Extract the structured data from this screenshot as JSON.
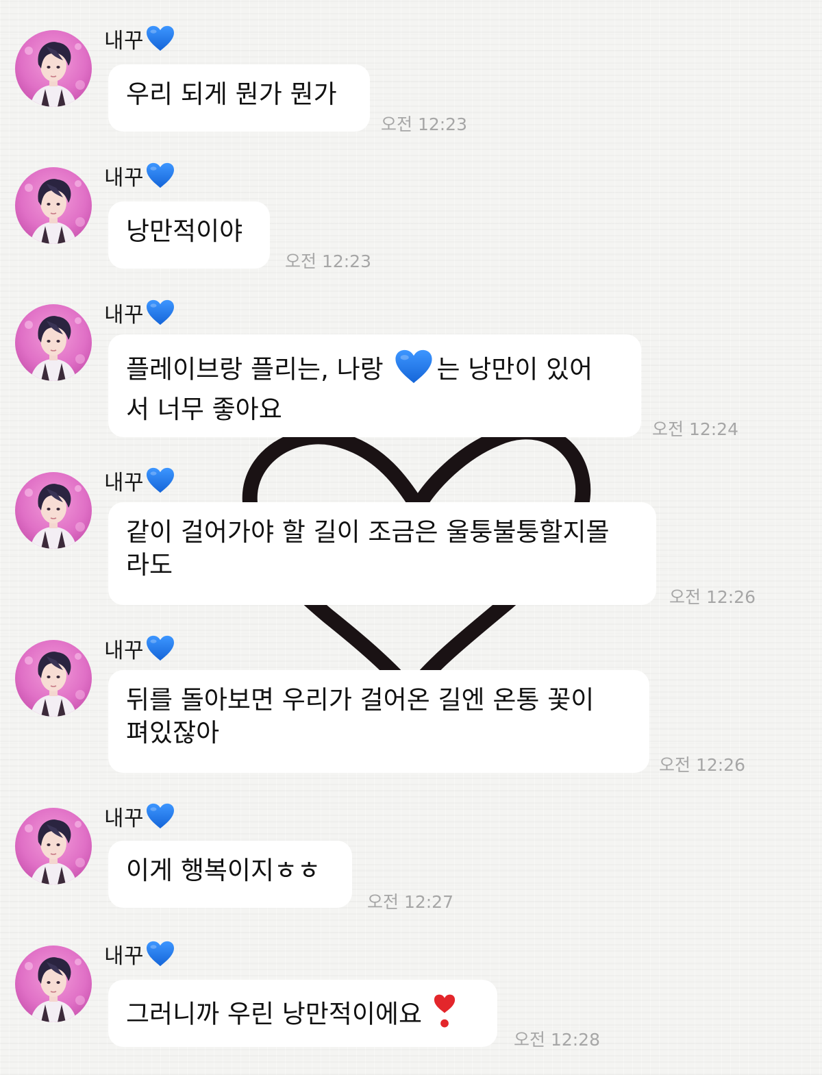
{
  "colors": {
    "background": "#f4f4f2",
    "bubble": "#ffffff",
    "text": "#111111",
    "timestamp": "#a6a6a6",
    "sender_heart": "#1f7ae8",
    "red_heart": "#e3262b",
    "avatar_bg": "#e070c6"
  },
  "icons": {
    "sender_badge": "blue-heart-icon",
    "inline": "blue-heart-icon",
    "ending": "red-heart-exclamation-icon",
    "background": "hand-drawn-heart"
  },
  "messages": [
    {
      "sender": "내꾸",
      "text": "우리 되게 뭔가 뭔가",
      "time": "오전 12:23"
    },
    {
      "sender": "내꾸",
      "text": "낭만적이야",
      "time": "오전 12:23"
    },
    {
      "sender": "내꾸",
      "text_a": "플레이브랑 플리는, 나랑 ",
      "text_b": "는 낭만이 있어",
      "text_c": "서 너무 좋아요",
      "time": "오전 12:24"
    },
    {
      "sender": "내꾸",
      "text": "같이 걸어가야 할 길이 조금은 울퉁불퉁할지몰\n라도",
      "time": "오전 12:26"
    },
    {
      "sender": "내꾸",
      "text": "뒤를 돌아보면 우리가 걸어온 길엔 온통 꽃이\n펴있잖아",
      "time": "오전 12:26"
    },
    {
      "sender": "내꾸",
      "text": "이게 행복이지ㅎㅎ",
      "time": "오전 12:27"
    },
    {
      "sender": "내꾸",
      "text": "그러니까 우린 낭만적이에요 ",
      "time": "오전 12:28"
    }
  ]
}
